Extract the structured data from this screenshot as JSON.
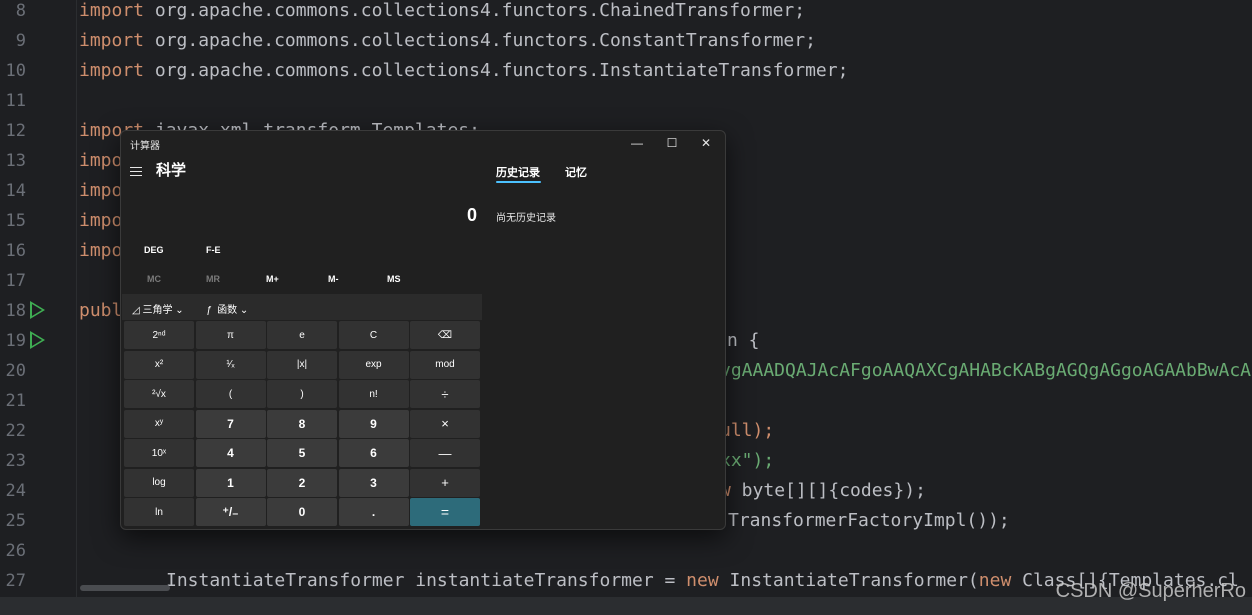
{
  "editor": {
    "line_numbers": [
      "8",
      "9",
      "10",
      "11",
      "12",
      "13",
      "14",
      "15",
      "16",
      "17",
      "18",
      "19",
      "20",
      "21",
      "22",
      "23",
      "24",
      "25",
      "26",
      "27"
    ],
    "lines": [
      {
        "kw": "import",
        "rest": " org.apache.commons.collections4.functors.ChainedTransformer;"
      },
      {
        "kw": "import",
        "rest": " org.apache.commons.collections4.functors.ConstantTransformer;"
      },
      {
        "kw": "import",
        "rest": " org.apache.commons.collections4.functors.InstantiateTransformer;"
      },
      {
        "kw": "",
        "rest": ""
      },
      {
        "kw": "import",
        "rest": " javax.xml.transform.Templates;"
      },
      {
        "kw": "impo",
        "rest": ""
      },
      {
        "kw": "impo",
        "rest": ""
      },
      {
        "kw": "impo",
        "rest": ""
      },
      {
        "kw": "impo",
        "rest": ""
      },
      {
        "kw": "",
        "rest": ""
      },
      {
        "kw": "publ",
        "rest": ""
      },
      {
        "kw": "",
        "rest": ""
      }
    ],
    "right_fragments": {
      "l19": "n {",
      "l20": "vgAAADQAJAcAFgoAAQAXCgAHABcKABgAGQgAGgoAGAAbBwAcA",
      "l22": "ull);",
      "l23": "xx\");",
      "l24_kw": "w",
      "l24_rest": " byte[][]{codes});",
      "l25": "TransformerFactoryImpl());"
    },
    "line27": {
      "t1": "InstantiateTransformer instantiateTransformer = ",
      "k1": "new",
      "t2": " InstantiateTransformer(",
      "k2": "new",
      "t3": " Class[]{Templates.cl"
    }
  },
  "watermark": "CSDN @SuperherRo",
  "calculator": {
    "window_title": "计算器",
    "controls": {
      "minimize": "—",
      "maximize": "☐",
      "close": "✕"
    },
    "mode": "科学",
    "display": "0",
    "tabs": {
      "history": "历史记录",
      "memory": "记忆"
    },
    "history_empty": "尚无历史记录",
    "angle": {
      "deg": "DEG",
      "fe": "F-E"
    },
    "memory": {
      "mc": "MC",
      "mr": "MR",
      "mplus": "M+",
      "mminus": "M-",
      "ms": "MS"
    },
    "functions": {
      "trig": "三角学",
      "func": "函数"
    },
    "keys": [
      "2ⁿᵈ",
      "π",
      "e",
      "C",
      "⌫",
      "x²",
      "¹⁄ₓ",
      "|x|",
      "exp",
      "mod",
      "²√x",
      "(",
      ")",
      "n!",
      "÷",
      "xʸ",
      "7",
      "8",
      "9",
      "×",
      "10ˣ",
      "4",
      "5",
      "6",
      "—",
      "log",
      "1",
      "2",
      "3",
      "+",
      "ln",
      "⁺/₋",
      "0",
      ".",
      "="
    ]
  },
  "colors": {
    "accent": "#4cc2ff",
    "equals_key": "#2d6b7a",
    "keyword": "#cf8e6d",
    "string": "#6aab73"
  }
}
